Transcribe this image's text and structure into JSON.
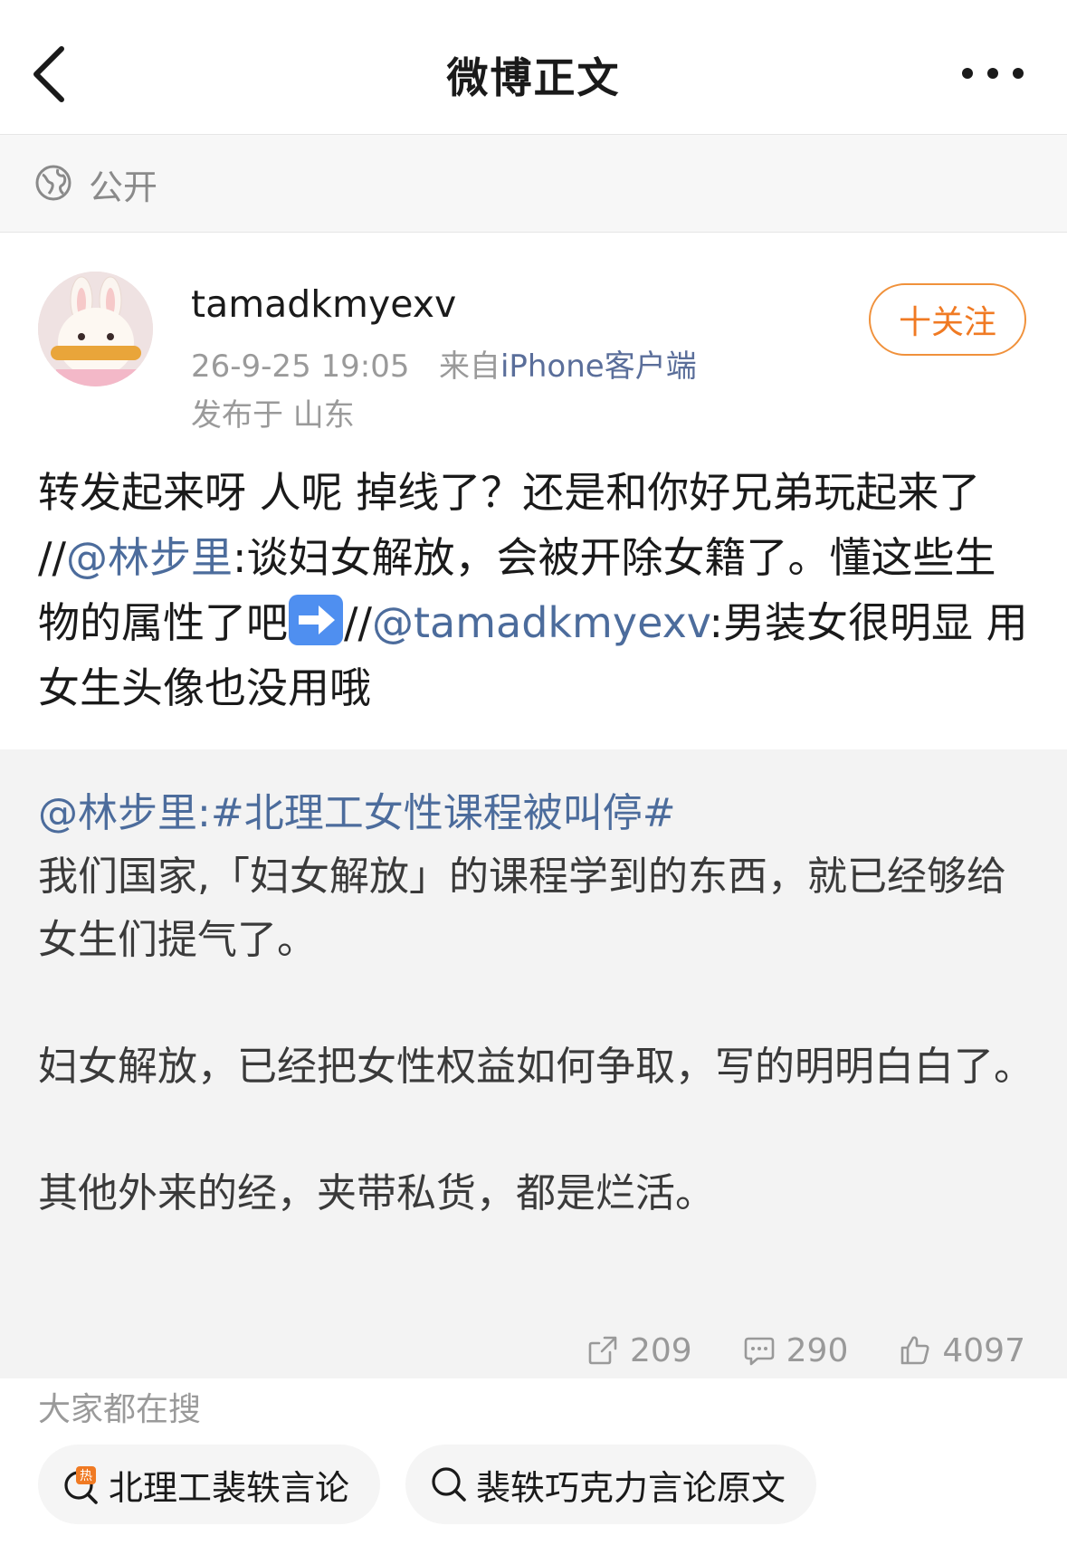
{
  "header": {
    "title": "微博正文",
    "back_icon": "chevron-left-icon",
    "more_icon": "more-horizontal-icon"
  },
  "visibility": {
    "icon": "globe-icon",
    "label": "公开"
  },
  "post": {
    "username": "tamadkmyexv",
    "timestamp": "26-9-25 19:05",
    "from_label": "来自",
    "source": "iPhone客户端",
    "location": "发布于 山东",
    "follow_label": "十关注",
    "text_parts": {
      "p1": "转发起来呀 人呢 掉线了？还是和你好兄弟玩起来了 //",
      "m1": "@林步里",
      "p2": ":谈妇女解放，会被开除女籍了。懂这些生物的属性了吧",
      "p3": "//",
      "m2": "@tamadkmyexv",
      "p4": ":男装女很明显 用女生头像也没用哦"
    }
  },
  "quoted": {
    "mention": "@林步里",
    "colon": ":",
    "hashtag": "#北理工女性课程被叫停#",
    "para1": "我们国家,「妇女解放」的课程学到的东西，就已经够给女生们提气了。",
    "para2": "妇女解放，已经把女性权益如何争取，写的明明白白了。",
    "para3": "其他外来的经，夹带私货，都是烂活。",
    "reposts": "209",
    "comments": "290",
    "likes": "4097"
  },
  "search": {
    "title": "大家都在搜",
    "chips": [
      {
        "label": "北理工裴轶言论",
        "icon": "hot-search-icon"
      },
      {
        "label": "裴轶巧克力言论原文",
        "icon": "search-icon"
      }
    ]
  },
  "colors": {
    "accent_orange": "#f07a23",
    "link_blue": "#4c6c9c",
    "quoted_bg": "#f3f3f3"
  }
}
